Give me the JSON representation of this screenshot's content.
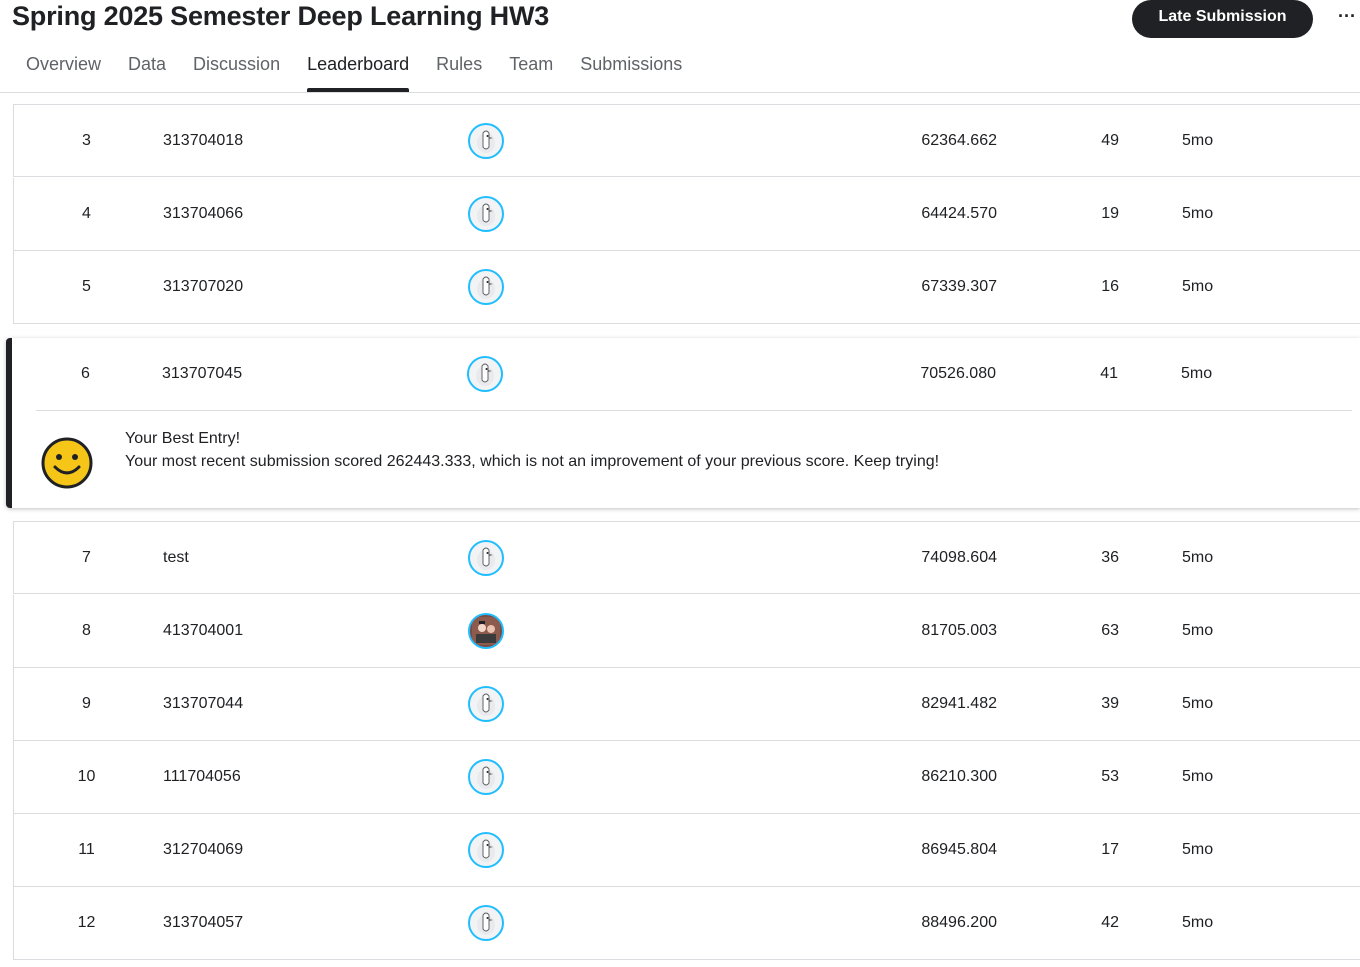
{
  "page": {
    "title": "Spring 2025 Semester Deep Learning HW3",
    "late_submission_label": "Late Submission",
    "more_label": "···"
  },
  "tabs": [
    "Overview",
    "Data",
    "Discussion",
    "Leaderboard",
    "Rules",
    "Team",
    "Submissions"
  ],
  "active_tab": "Leaderboard",
  "rows_before": [
    {
      "rank": "3",
      "team": "313704018",
      "score": "62364.662",
      "entries": "49",
      "last": "5mo"
    },
    {
      "rank": "4",
      "team": "313704066",
      "score": "64424.570",
      "entries": "19",
      "last": "5mo"
    },
    {
      "rank": "5",
      "team": "313707020",
      "score": "67339.307",
      "entries": "16",
      "last": "5mo"
    }
  ],
  "my_entry": {
    "rank": "6",
    "team": "313707045",
    "score": "70526.080",
    "entries": "41",
    "last": "5mo",
    "best_title": "Your Best Entry!",
    "best_message": "Your most recent submission scored 262443.333, which is not an improvement of your previous score. Keep trying!"
  },
  "rows_after": [
    {
      "rank": "7",
      "team": "test",
      "score": "74098.604",
      "entries": "36",
      "last": "5mo",
      "avatar": "goose-avatar"
    },
    {
      "rank": "8",
      "team": "413704001",
      "score": "81705.003",
      "entries": "63",
      "last": "5mo",
      "avatar": "photo-avatar"
    },
    {
      "rank": "9",
      "team": "313707044",
      "score": "82941.482",
      "entries": "39",
      "last": "5mo",
      "avatar": "goose-avatar"
    },
    {
      "rank": "10",
      "team": "111704056",
      "score": "86210.300",
      "entries": "53",
      "last": "5mo",
      "avatar": "goose-avatar"
    },
    {
      "rank": "11",
      "team": "312704069",
      "score": "86945.804",
      "entries": "17",
      "last": "5mo",
      "avatar": "goose-avatar"
    },
    {
      "rank": "12",
      "team": "313704057",
      "score": "88496.200",
      "entries": "42",
      "last": "5mo",
      "avatar": "goose-avatar"
    }
  ],
  "colors": {
    "avatar_ring": "#20beff",
    "accent_dark": "#202124",
    "smiley_fill": "#f5c518"
  }
}
